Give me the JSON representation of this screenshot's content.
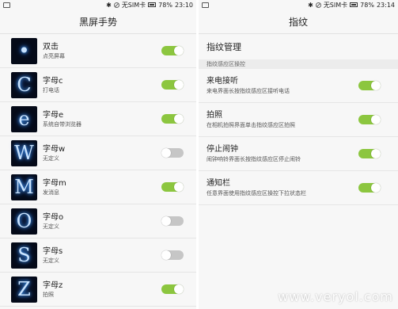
{
  "left": {
    "status": {
      "carrier": "无SIM卡",
      "battery": "78%",
      "time": "23:10"
    },
    "title": "黑屏手势",
    "gestures": [
      {
        "glyph": "•",
        "icon_name": "double-tap-gesture-icon",
        "title": "双击",
        "subtitle": "点亮屏幕",
        "enabled": true
      },
      {
        "glyph": "C",
        "icon_name": "letter-c-gesture-icon",
        "title": "字母c",
        "subtitle": "打电话",
        "enabled": true
      },
      {
        "glyph": "e",
        "icon_name": "letter-e-gesture-icon",
        "title": "字母e",
        "subtitle": "系统自带浏览器",
        "enabled": true
      },
      {
        "glyph": "W",
        "icon_name": "letter-w-gesture-icon",
        "title": "字母w",
        "subtitle": "无定义",
        "enabled": false
      },
      {
        "glyph": "M",
        "icon_name": "letter-m-gesture-icon",
        "title": "字母m",
        "subtitle": "发消息",
        "enabled": true
      },
      {
        "glyph": "O",
        "icon_name": "letter-o-gesture-icon",
        "title": "字母o",
        "subtitle": "无定义",
        "enabled": false
      },
      {
        "glyph": "S",
        "icon_name": "letter-s-gesture-icon",
        "title": "字母s",
        "subtitle": "无定义",
        "enabled": false
      },
      {
        "glyph": "Z",
        "icon_name": "letter-z-gesture-icon",
        "title": "字母z",
        "subtitle": "拍照",
        "enabled": true
      }
    ]
  },
  "right": {
    "status": {
      "carrier": "无SIM卡",
      "battery": "78%",
      "time": "23:14"
    },
    "title": "指纹",
    "management": "指纹管理",
    "section_header": "指纹感应区操控",
    "items": [
      {
        "title": "来电接听",
        "subtitle": "来电界面长按指纹感应区接听电话",
        "enabled": true
      },
      {
        "title": "拍照",
        "subtitle": "在相机拍照界面单击指纹感应区拍照",
        "enabled": true
      },
      {
        "title": "停止闹钟",
        "subtitle": "闹钟响铃界面长按指纹感应区停止闹铃",
        "enabled": true
      },
      {
        "title": "通知栏",
        "subtitle": "任意界面使用指纹感应区操控下拉状态栏",
        "enabled": true
      }
    ]
  },
  "watermark": "www.veryol.com",
  "colors": {
    "toggle_on": "#8cc63f",
    "toggle_off": "#c6c6c6",
    "glow": "#4aa8ff"
  }
}
